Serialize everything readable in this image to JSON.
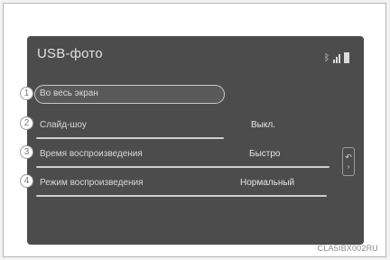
{
  "screen": {
    "title": "USB-фото",
    "status_icons": [
      "bluetooth-icon",
      "signal-icon",
      "battery-icon"
    ]
  },
  "menu": [
    {
      "number": "1",
      "label": "Во весь экран",
      "value": "",
      "selected": true
    },
    {
      "number": "2",
      "label": "Слайд-шоу",
      "value": "Выкл."
    },
    {
      "number": "3",
      "label": "Время воспроизведения",
      "value": "Быстро"
    },
    {
      "number": "4",
      "label": "Режим воспроизведения",
      "value": "Нормальный"
    }
  ],
  "back_button": {
    "icon": "back-arrow-icon"
  },
  "caption": "CLA5IBX002RU",
  "colors": {
    "screen_bg": "#4c4c4c",
    "text": "#dcdcdc",
    "badge_bg": "#ffffff"
  }
}
